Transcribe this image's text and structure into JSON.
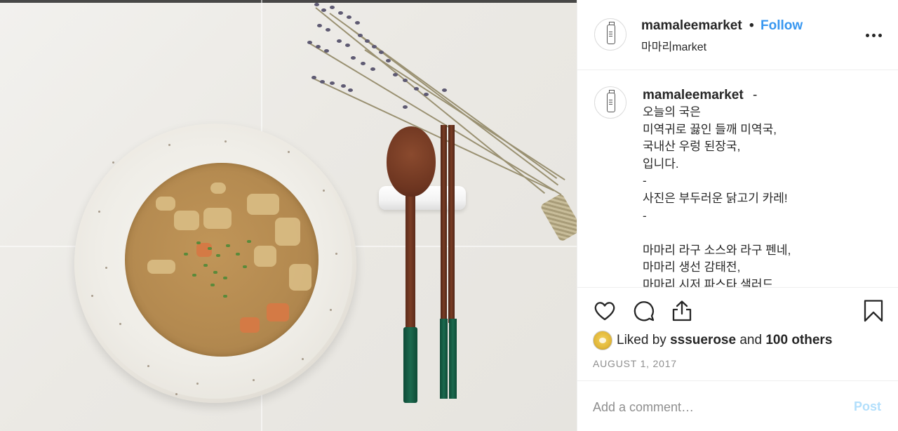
{
  "post": {
    "username": "mamaleemarket",
    "dot": "•",
    "follow_label": "Follow",
    "location": "마마리market",
    "more_label": "More options"
  },
  "caption": {
    "username": "mamaleemarket",
    "dash": "-",
    "lines": [
      "오늘의 국은",
      "미역귀로 끓인 들깨 미역국,",
      "국내산 우렁 된장국,",
      "입니다.",
      "-",
      "사진은 부두러운 닭고기 카레!",
      "-",
      "",
      "마마리 라구 소스와 라구 펜네,",
      "마마리 생선 감태전,",
      "마마리 시저  파스타 샐러드"
    ]
  },
  "likes": {
    "prefix": "Liked by",
    "user": "sssuerose",
    "and": "and",
    "others": "100 others"
  },
  "date": "AUGUST 1, 2017",
  "comment_box": {
    "placeholder": "Add a comment…",
    "post_label": "Post"
  },
  "icons": {
    "like": "heart-icon",
    "comment": "comment-icon",
    "share": "share-icon",
    "save": "bookmark-icon",
    "more": "more-dots-icon"
  },
  "colors": {
    "follow": "#3897f0",
    "post_disabled": "#b2dffc",
    "muted": "#8e8e8e",
    "text": "#262626"
  }
}
